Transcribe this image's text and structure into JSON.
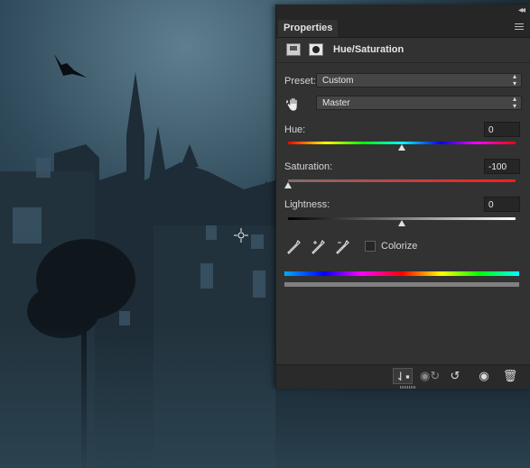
{
  "panel": {
    "tab_label": "Properties",
    "title": "Hue/Saturation"
  },
  "preset": {
    "label": "Preset:",
    "value": "Custom"
  },
  "channel": {
    "value": "Master"
  },
  "hue": {
    "label": "Hue:",
    "value": "0",
    "level": 0.5
  },
  "saturation": {
    "label": "Saturation:",
    "value": "-100",
    "level": 0.0
  },
  "lightness": {
    "label": "Lightness:",
    "value": "0",
    "level": 0.5
  },
  "colorize": {
    "label": "Colorize",
    "checked": false
  },
  "icons": {
    "collapse": "double-chevron-icon",
    "menu": "hamburger-menu-icon",
    "adjustment": "adjustment-layer-icon",
    "mask": "layer-mask-icon",
    "targeted": "hand-target-icon",
    "eyedroppers": [
      "eyedropper-icon",
      "eyedropper-plus-icon",
      "eyedropper-minus-icon"
    ],
    "bottom": [
      "clip-to-layer-icon",
      "view-previous-icon",
      "reset-icon",
      "visibility-eye-icon",
      "trash-icon"
    ]
  }
}
